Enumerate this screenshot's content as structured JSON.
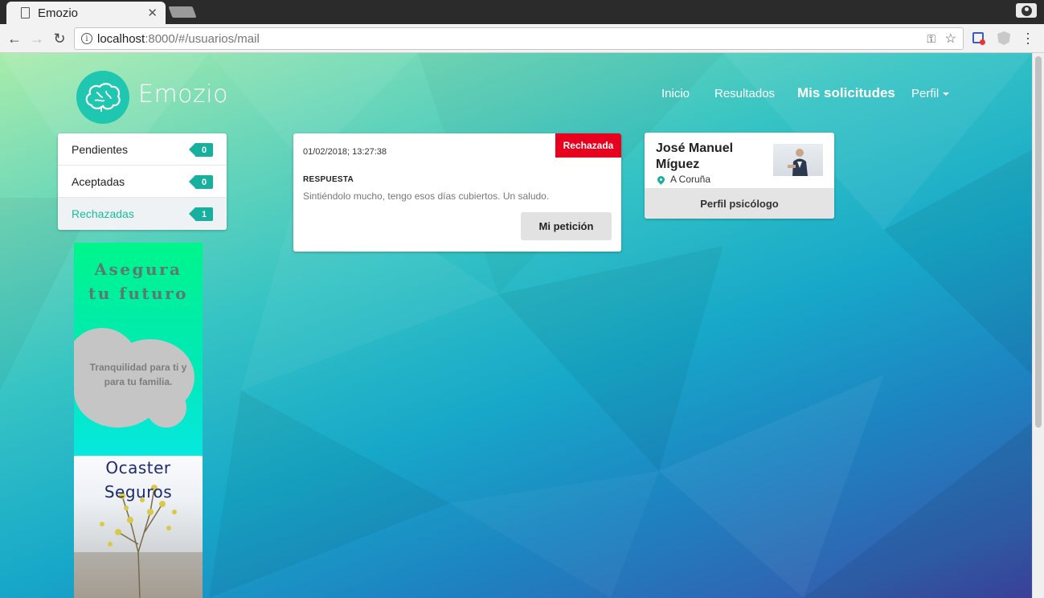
{
  "browser": {
    "tab_title": "Emozio",
    "url_host": "localhost",
    "url_path": ":8000/#/usuarios/mail"
  },
  "site": {
    "brand": "Emozio",
    "nav": [
      "Inicio",
      "Resultados",
      "Mis solicitudes",
      "Perfil"
    ],
    "active_nav": "Mis solicitudes"
  },
  "sidebar": {
    "items": [
      {
        "label": "Pendientes",
        "count": "0"
      },
      {
        "label": "Aceptadas",
        "count": "0"
      },
      {
        "label": "Rechazadas",
        "count": "1"
      }
    ],
    "active": "Rechazadas"
  },
  "ad": {
    "headline_1": "Asegura",
    "headline_2": "tu futuro",
    "subtext_1": "Tranquilidad para ti y",
    "subtext_2": "para tu familia.",
    "brand_1": "Ocaster",
    "brand_2": "Seguros"
  },
  "message": {
    "status": "Rechazada",
    "status_color": "#e8001f",
    "date": "01/02/2018; 13:27:38",
    "label": "RESPUESTA",
    "text": "Sintiéndolo mucho, tengo esos días cubiertos. Un saludo.",
    "button": "Mi petición"
  },
  "profile": {
    "name_1": "José Manuel",
    "name_2": "Míguez",
    "location": "A Coruña",
    "button": "Perfil psicólogo"
  },
  "colors": {
    "accent": "#17b09e",
    "danger": "#e8001f"
  }
}
